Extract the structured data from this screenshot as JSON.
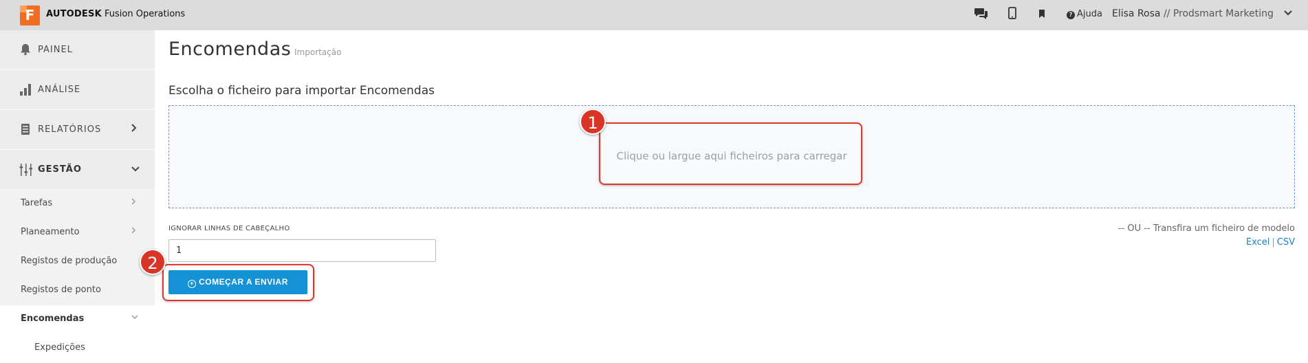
{
  "topbar": {
    "logo_letter": "F",
    "brand_bold": "AUTODESK",
    "brand_rest": "Fusion Operations",
    "icons": [
      "chat-icon",
      "mobile-icon",
      "bookmark-icon"
    ],
    "help_label": "Ajuda",
    "user_name": "Elisa Rosa",
    "user_org": "// Prodsmart Marketing"
  },
  "sidebar": {
    "top_items": [
      {
        "label": "PAINEL",
        "icon": "bell-icon"
      },
      {
        "label": "ANÁLISE",
        "icon": "bar-chart-icon"
      },
      {
        "label": "RELATÓRIOS",
        "icon": "document-icon",
        "chevron": "right"
      },
      {
        "label": "GESTÃO",
        "icon": "sliders-icon",
        "chevron": "down"
      }
    ],
    "sub_items": [
      {
        "label": "Tarefas",
        "chevron": "right"
      },
      {
        "label": "Planeamento",
        "chevron": "right"
      },
      {
        "label": "Registos de produção"
      },
      {
        "label": "Registos de ponto"
      },
      {
        "label": "Encomendas",
        "chevron": "down",
        "active": true
      },
      {
        "label": "Expedições"
      }
    ]
  },
  "main": {
    "title": "Encomendas",
    "subtitle": "Importação",
    "section_heading": "Escolha o ficheiro para importar Encomendas",
    "dropzone_text": "Clique ou largue aqui ficheiros para carregar",
    "ignore_label": "IGNORAR LINHAS DE CABEÇALHO",
    "ignore_value": "1",
    "start_button": "COMEÇAR A ENVIAR",
    "template_text": "-- OU -- Transfira um ficheiro de modelo",
    "template_excel": "Excel",
    "template_sep": "|",
    "template_csv": "CSV"
  },
  "annotations": [
    {
      "number": "1"
    },
    {
      "number": "2"
    }
  ],
  "colors": {
    "accent": "#1592d6",
    "annotation": "#e0372a",
    "brand": "#f26d21"
  }
}
